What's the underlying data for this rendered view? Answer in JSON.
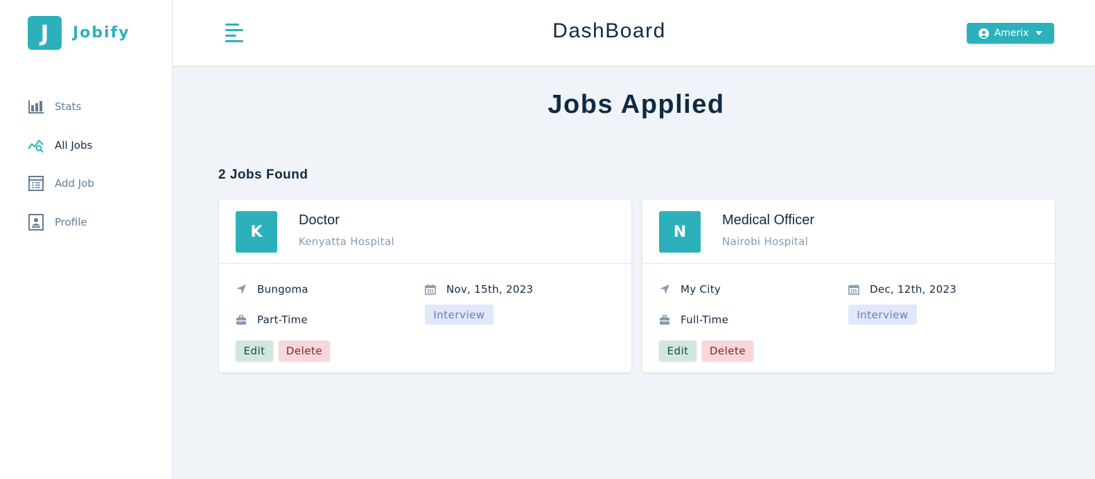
{
  "brand": {
    "logo_letter": "J",
    "name": "Jobify",
    "accent": "#2cb1bc"
  },
  "sidebar": {
    "items": [
      {
        "label": "Stats",
        "icon": "bar-chart-icon",
        "active": false
      },
      {
        "label": "All Jobs",
        "icon": "query-stats-icon",
        "active": true
      },
      {
        "label": "Add Job",
        "icon": "form-icon",
        "active": false
      },
      {
        "label": "Profile",
        "icon": "id-card-icon",
        "active": false
      }
    ]
  },
  "header": {
    "title": "DashBoard",
    "user": "Amerix"
  },
  "main": {
    "title": "Jobs Applied",
    "count_text": "2 Jobs Found",
    "jobs": [
      {
        "initial": "K",
        "position": "Doctor",
        "company": "Kenyatta Hospital",
        "location": "Bungoma",
        "date": "Nov, 15th, 2023",
        "type": "Part-Time",
        "status": "Interview",
        "edit": "Edit",
        "delete": "Delete"
      },
      {
        "initial": "N",
        "position": "Medical Officer",
        "company": "Nairobi Hospital",
        "location": "My City",
        "date": "Dec, 12th, 2023",
        "type": "Full-Time",
        "status": "Interview",
        "edit": "Edit",
        "delete": "Delete"
      }
    ]
  },
  "colors": {
    "edit_bg": "#d1e7dd",
    "delete_bg": "#f8d7da",
    "status_bg": "#e0e8f9",
    "main_bg": "#f0f4f8"
  }
}
